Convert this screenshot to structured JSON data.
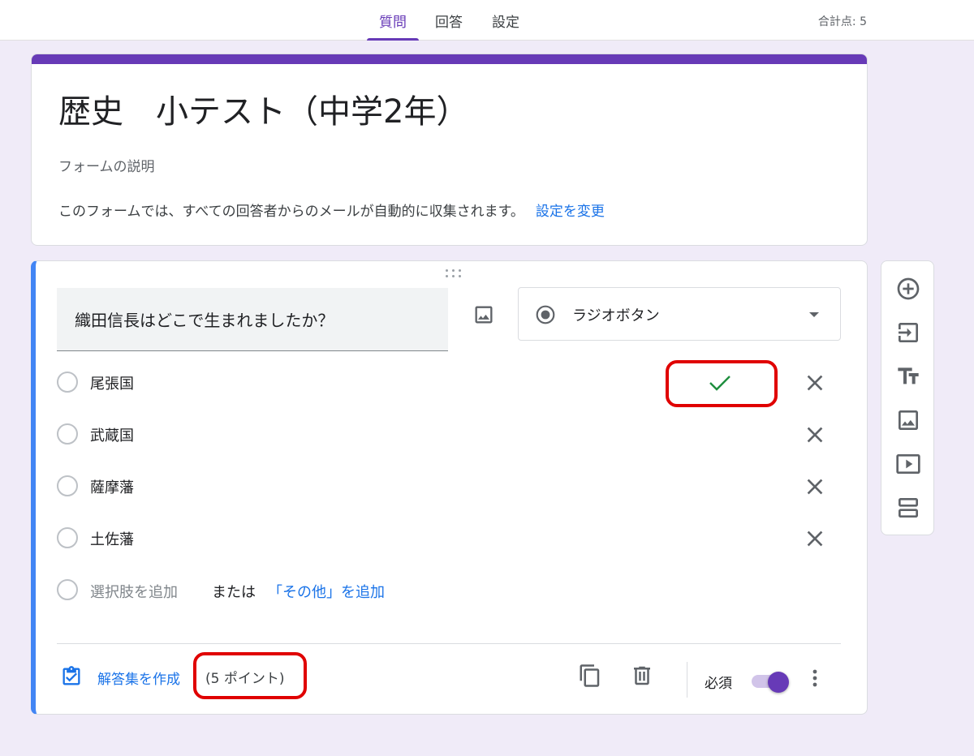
{
  "topbar": {
    "tabs": [
      {
        "label": "質問",
        "active": true
      },
      {
        "label": "回答",
        "active": false
      },
      {
        "label": "設定",
        "active": false
      }
    ],
    "total_points": "合計点: 5"
  },
  "form": {
    "title": "歴史　小テスト（中学2年）",
    "description_placeholder": "フォームの説明",
    "email_note": "このフォームでは、すべての回答者からのメールが自動的に収集されます。",
    "change_settings_link": "設定を変更"
  },
  "question": {
    "title": "織田信長はどこで生まれましたか？",
    "type": {
      "label": "ラジオボタン",
      "icon": "radio-button-checked-icon"
    },
    "options": [
      {
        "label": "尾張国",
        "correct": true
      },
      {
        "label": "武蔵国",
        "correct": false
      },
      {
        "label": "薩摩藩",
        "correct": false
      },
      {
        "label": "土佐藩",
        "correct": false
      }
    ],
    "add_option": "選択肢を追加",
    "or": "または",
    "add_other": "「その他」を追加",
    "answer_key": "解答集を作成",
    "points": "(5 ポイント)",
    "required_label": "必須",
    "required": true
  },
  "side_toolbar": [
    "add-question-icon",
    "import-questions-icon",
    "add-title-icon",
    "add-image-icon",
    "add-video-icon",
    "add-section-icon"
  ],
  "colors": {
    "accent": "#673ab7",
    "link": "#1a73e8",
    "correct": "#1e8e3e",
    "highlight": "#e00000",
    "background": "#f0ebf8"
  }
}
